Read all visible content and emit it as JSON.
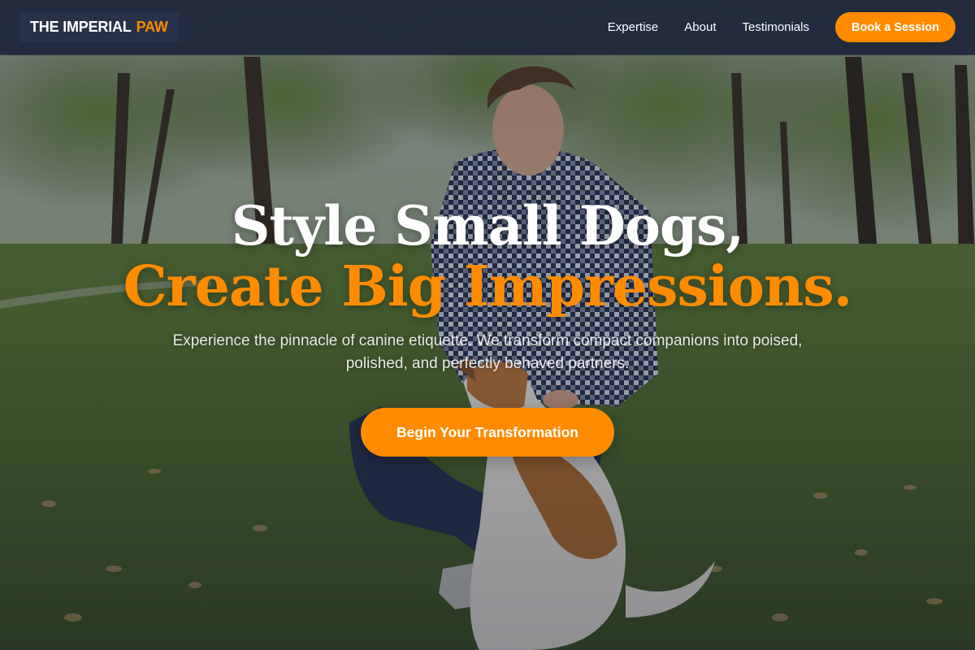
{
  "header": {
    "brand_main": "THE IMPERIAL",
    "brand_accent": "PAW",
    "nav": [
      "Expertise",
      "About",
      "Testimonials"
    ],
    "cta": "Book a Session"
  },
  "hero": {
    "headline_line1": "Style Small Dogs,",
    "headline_line2": "Create Big Impressions.",
    "subtext": "Experience the pinnacle of canine etiquette. We transform compact companions into poised, polished, and perfectly behaved partners.",
    "cta": "Begin Your Transformation",
    "background_image": "man-kneeling-with-small-dog-in-park-photo"
  },
  "colors": {
    "accent": "#ff8c00",
    "navbar": "#1c263a",
    "text": "#ffffff"
  }
}
